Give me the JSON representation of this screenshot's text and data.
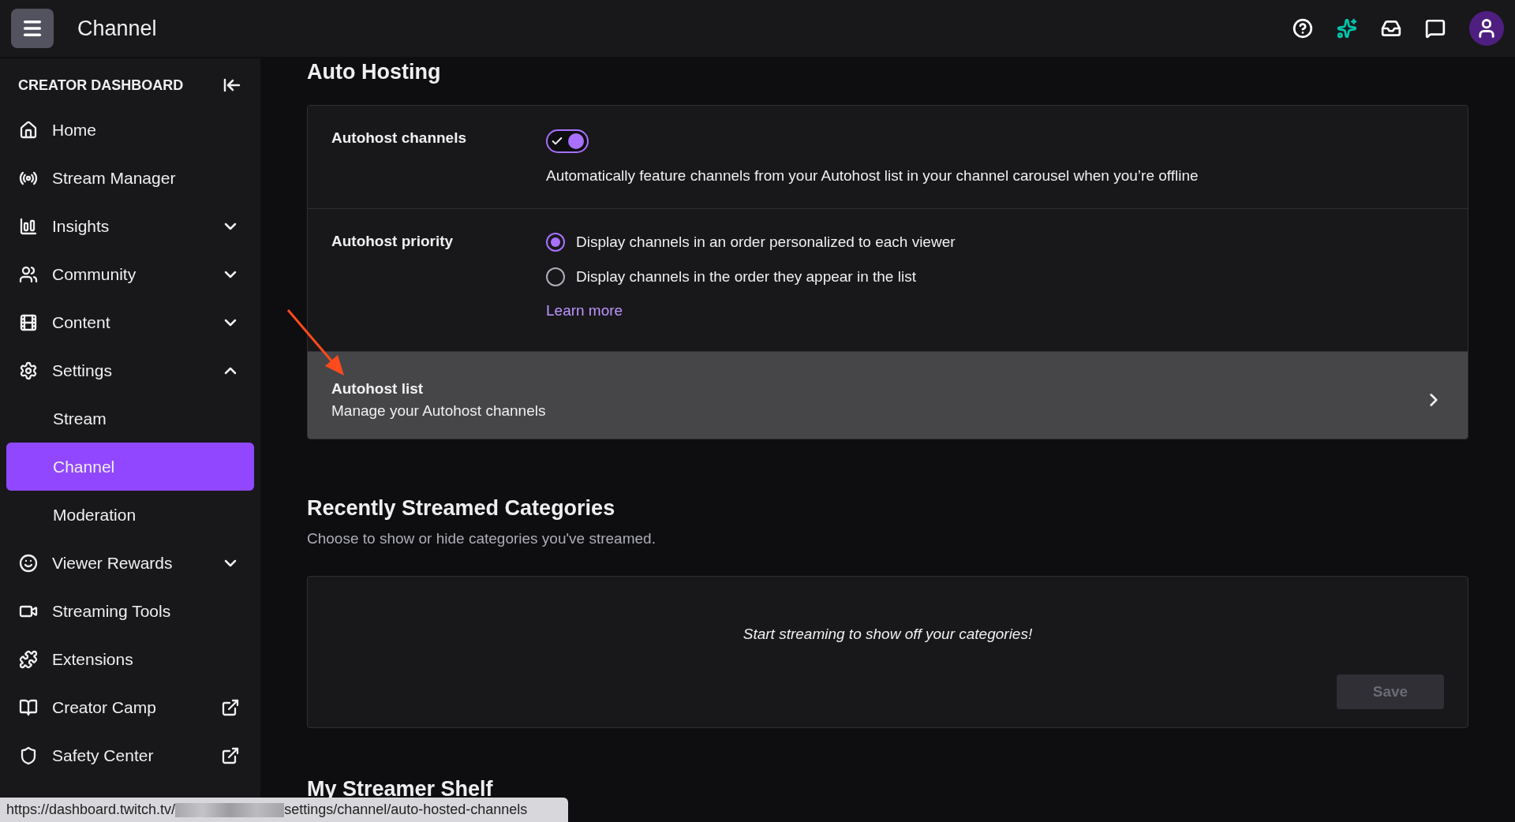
{
  "topbar": {
    "title": "Channel"
  },
  "sidebar": {
    "heading": "CREATOR DASHBOARD",
    "items": [
      {
        "label": "Home",
        "kind": "plain"
      },
      {
        "label": "Stream Manager",
        "kind": "plain"
      },
      {
        "label": "Insights",
        "kind": "expandable",
        "expanded": false
      },
      {
        "label": "Community",
        "kind": "expandable",
        "expanded": false
      },
      {
        "label": "Content",
        "kind": "expandable",
        "expanded": false
      },
      {
        "label": "Settings",
        "kind": "expandable",
        "expanded": true,
        "children": [
          {
            "label": "Stream",
            "selected": false
          },
          {
            "label": "Channel",
            "selected": true
          },
          {
            "label": "Moderation",
            "selected": false
          }
        ]
      },
      {
        "label": "Viewer Rewards",
        "kind": "expandable",
        "expanded": false
      },
      {
        "label": "Streaming Tools",
        "kind": "plain"
      },
      {
        "label": "Extensions",
        "kind": "plain"
      },
      {
        "label": "Creator Camp",
        "kind": "external"
      },
      {
        "label": "Safety Center",
        "kind": "external"
      }
    ]
  },
  "auto_hosting": {
    "title": "Auto Hosting",
    "rows": [
      {
        "kind": "toggle",
        "label": "Autohost channels",
        "on": true,
        "description": "Automatically feature channels from your Autohost list in your channel carousel when you’re offline"
      },
      {
        "kind": "radio",
        "label": "Autohost priority",
        "options": [
          {
            "label": "Display channels in an order personalized to each viewer",
            "selected": true
          },
          {
            "label": "Display channels in the order they appear in the list",
            "selected": false
          }
        ],
        "link": "Learn more"
      },
      {
        "kind": "link",
        "label": "Autohost list",
        "description": "Manage your Autohost channels",
        "hovered": true
      }
    ]
  },
  "categories": {
    "title": "Recently Streamed Categories",
    "subtitle": "Choose to show or hide categories you've streamed.",
    "empty_message": "Start streaming to show off your categories!",
    "save_button": {
      "label": "Save",
      "disabled": true
    }
  },
  "next_section": {
    "title": "My Streamer Shelf"
  },
  "status_bar": {
    "url_start": "https://dashboard.twitch.tv/",
    "url_end": "settings/channel/auto-hosted-channels"
  }
}
